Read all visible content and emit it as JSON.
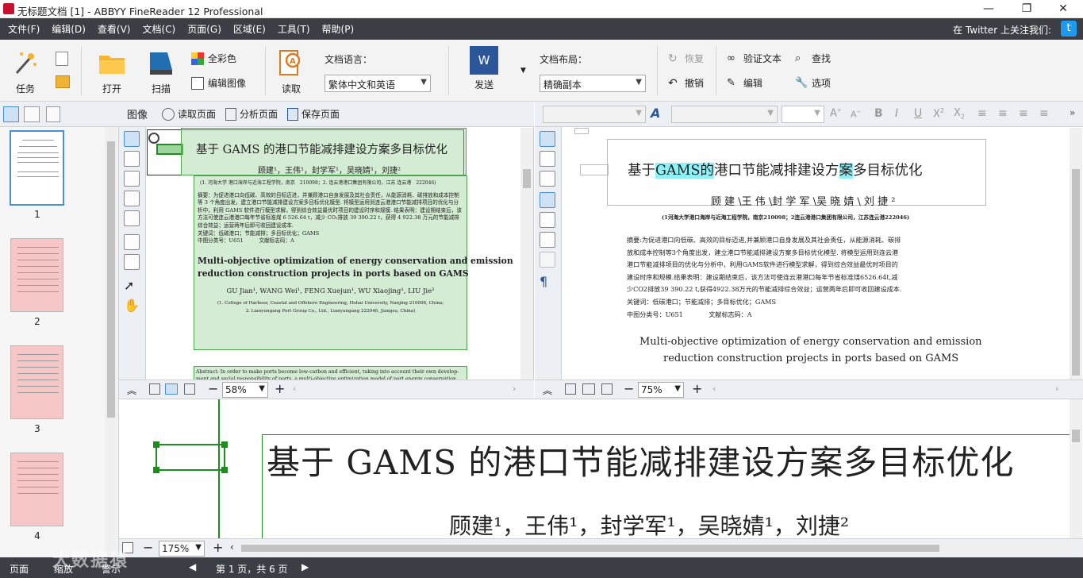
{
  "window": {
    "title": "无标题文档 [1] - ABBYY FineReader 12 Professional",
    "minimize": "—",
    "restore": "❐",
    "close": "✕"
  },
  "menu": {
    "items": [
      "文件(F)",
      "编辑(D)",
      "查看(V)",
      "文档(C)",
      "页面(G)",
      "区域(E)",
      "工具(T)",
      "帮助(P)"
    ],
    "twitter_text": "在 Twitter 上关注我们:",
    "twitter_icon": "twitter-icon"
  },
  "toolbar": {
    "task_label": "任务",
    "open_label": "打开",
    "scan_label": "扫描",
    "fullcolor_label": "全彩色",
    "editimage_label": "编辑图像",
    "read_label": "读取",
    "doclang_label": "文档语言：",
    "doclang_value": "繁体中文和英语",
    "send_label": "发送",
    "send_badge": "W",
    "layout_label": "文档布局：",
    "layout_value": "精确副本",
    "redo_label": "恢复",
    "undo_label": "撤销",
    "verify_label": "验证文本",
    "find_label": "查找",
    "edit_label": "编辑",
    "options_label": "选项"
  },
  "pages": {
    "items": [
      {
        "num": "1",
        "state": "selected"
      },
      {
        "num": "2",
        "state": "pink"
      },
      {
        "num": "3",
        "state": "pink"
      },
      {
        "num": "4",
        "state": "pink"
      }
    ]
  },
  "image_pane": {
    "title": "图像",
    "read_page": "读取页面",
    "analyze_page": "分析页面",
    "save_page": "保存页面",
    "zoom": "58%",
    "doc": {
      "title": "基于 GAMS 的港口节能减排建设方案多目标优化",
      "authors": "顾建¹，王伟¹，封学军¹，吴晓婧¹，刘捷²",
      "affil": "(1. 河海大学 港口海岸与近海工程学院，南京　210098；2. 连云港港口集团有限公司，江苏 连云港　222046)",
      "abstract_cn": "摘要：为促进港口向低碳、高效的目标迈进，并兼顾港口自身发展及其社会责任，从能源消耗、碳排放和成本控制等 3 个角度出发，建立港口节能减排建设方案多目标优化模型. 将模型运用到连云港港口节能减排项目的优化与分析中，利用 GAMS 软件进行模型求解，得到综合效益最优时项目的建设时序和规模. 结果表明：建设期结束后，该方法可使连云港港口每年节省标准煤 6 526.64 t，减少 CO₂排放 39 390.22 t，获得 4 922.38 万元的节能减排综合效益；运营两年后即可收回建设成本.",
      "keywords": "关键词：低碳港口；节能减排；多目标优化；GAMS",
      "classno": "中图分类号：U651　　　文献标志码：A",
      "en_title_1": "Multi-objective optimization of energy conservation and emission",
      "en_title_2": "reduction construction projects in ports based on GAMS",
      "en_authors": "GU Jian¹, WANG Wei¹, FENG Xuejun¹, WU Xiaojing¹, LIU Jie²",
      "en_affil_1": "(1. College of Harbour, Coastal and Offshore Engineering, Hohai University, Nanjing 210098, China;",
      "en_affil_2": "2. Lianyungang Port Group Co., Ltd., Lianyungang 222046, Jiangsu, China)",
      "abstract_en": "Abstract: In order to make ports become low-carbon and efficient, taking into account their own develop-ment and social responsibility of ports, a multi-objective optimization model of port energy conservation"
    }
  },
  "text_pane": {
    "zoom": "75%",
    "doc": {
      "title_a": "基于",
      "title_b": "GAMS的",
      "title_c": "港口节能减排建设方",
      "title_d": "案",
      "title_e": "多目标优化",
      "authors": "顾 建 \\王 伟 \\封 学 军 \\吴 晓 婧 \\ 刘 捷 ²",
      "affil": "(1河海大学港口海岸与近海工程学院，南京210098；2连云港港口集团有限公司，江苏连云港222046)",
      "abs_lines": [
        "摘要:为促进港口向低碳、高效的目标迈进,并兼顾港口自身发展及其社会责任，从能源消耗、碳排",
        "放和成本控制等3个角度出发，建立港口节能减排建设方案多目标优化模型. 将模型运用到连云港",
        "港口节能减排项目的优化与分析中，利用GAMS软件进行模型求解，得到综合效益最优时项目的",
        "建设时序和规模.结果表明：建设期结束后，该方法可使连云港港口每年节省标准煤6526.64t,减",
        "少CO2排放39 390.22 t,获得4922.38万元的节能减排综合效益；运营两年后即可收回建设成本.",
        "关键词：低碳港口；节能减排；多目标优化；GAMS",
        "中图分类号：U651　　　　文献标志码：A"
      ],
      "en_title_1": "Multi-objective optimization of energy conservation and emission",
      "en_title_2": "reduction construction projects in ports based on GAMS"
    }
  },
  "zoom_pane": {
    "zoom": "175%",
    "title": "基于 GAMS 的港口节能减排建设方案多目标优化",
    "authors": "顾建¹，王伟¹，封学军¹，吴晓婧¹，刘捷²"
  },
  "status": {
    "page_tab": "页面",
    "zoom_tab": "缩放",
    "warn_tab": "警示",
    "page_info": "第 1 页，共 6 页",
    "watermark": "大数据猿"
  }
}
